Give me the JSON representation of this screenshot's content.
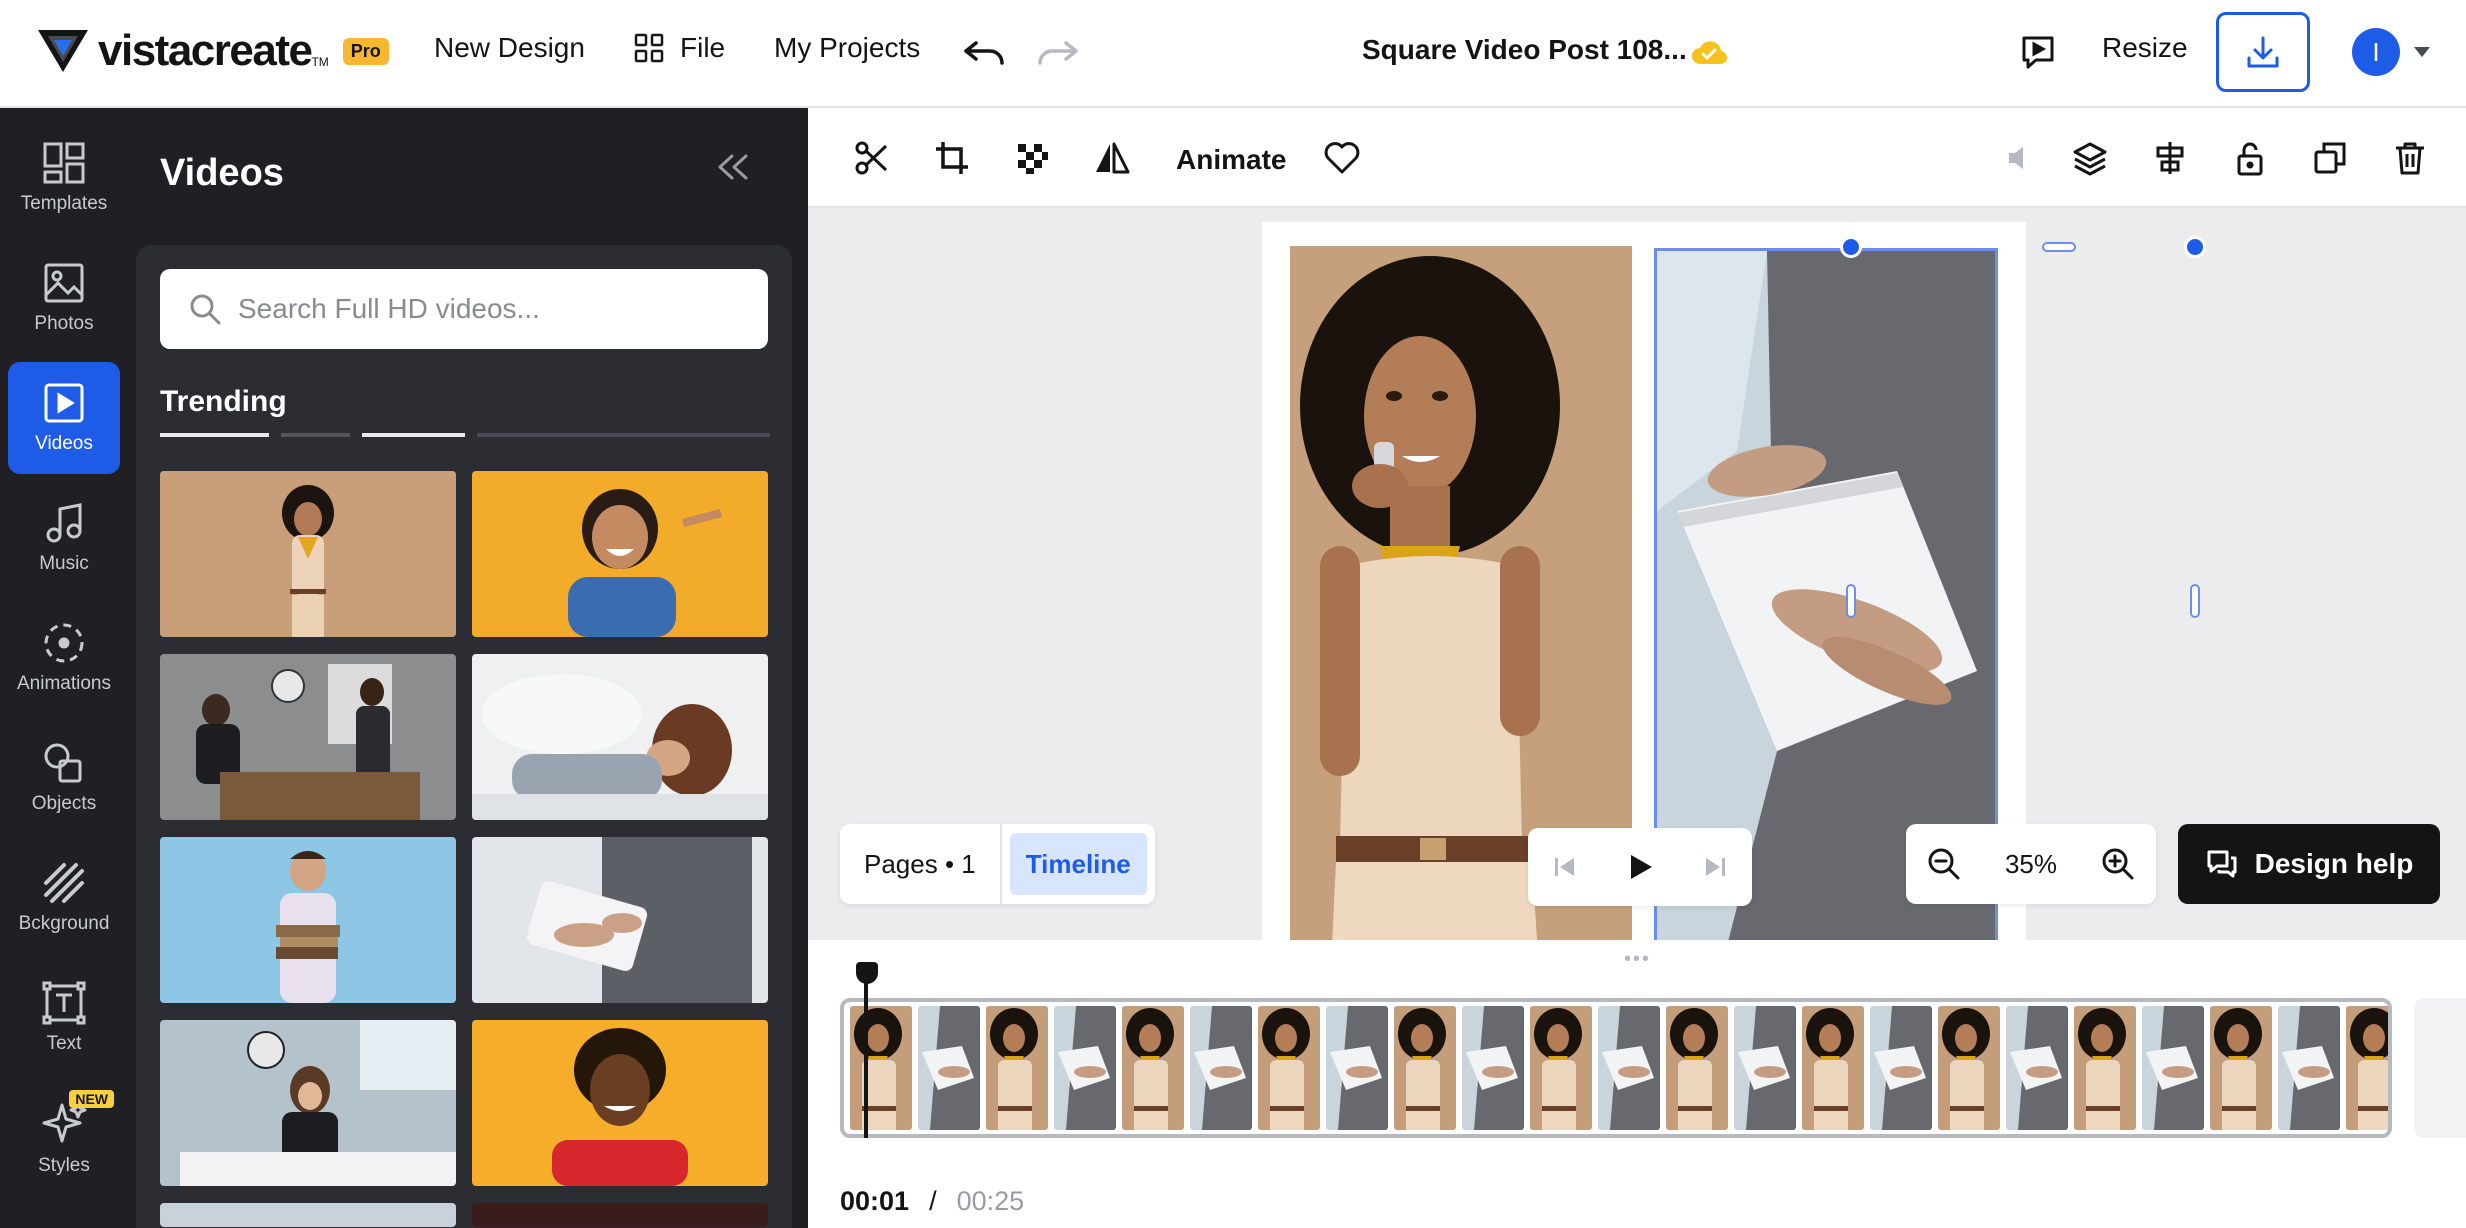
{
  "header": {
    "logo_text": "vistacreate",
    "logo_tm": "TM",
    "pro_badge": "Pro",
    "new_design": "New Design",
    "file": "File",
    "my_projects": "My Projects",
    "document_title": "Square Video Post 108...",
    "resize": "Resize",
    "avatar_initial": "I"
  },
  "rail": {
    "items": [
      {
        "label": "Templates",
        "icon": "templates-icon"
      },
      {
        "label": "Photos",
        "icon": "photos-icon"
      },
      {
        "label": "Videos",
        "icon": "videos-icon",
        "active": true
      },
      {
        "label": "Music",
        "icon": "music-icon"
      },
      {
        "label": "Animations",
        "icon": "animations-icon"
      },
      {
        "label": "Objects",
        "icon": "objects-icon"
      },
      {
        "label": "Bckground",
        "icon": "background-icon"
      },
      {
        "label": "Text",
        "icon": "text-icon"
      },
      {
        "label": "Styles",
        "icon": "styles-icon",
        "badge": "NEW"
      }
    ]
  },
  "panel": {
    "title": "Videos",
    "search_placeholder": "Search Full HD videos...",
    "section": "Trending",
    "thumbnails": [
      "woman-phone-beige",
      "girl-laughing-yellow",
      "office-meeting-clock",
      "woman-lying-bed",
      "man-holding-books",
      "hands-tablet-suit",
      "woman-desk-clock",
      "man-dreadlocks-red"
    ]
  },
  "toolbar": {
    "animate": "Animate",
    "left_icons": [
      "scissors-icon",
      "crop-icon",
      "transparency-icon",
      "flip-icon"
    ],
    "right_icons": [
      "volume-icon",
      "layers-icon",
      "align-icon",
      "lock-icon",
      "duplicate-icon",
      "delete-icon"
    ]
  },
  "canvas": {
    "pages_label": "Pages • 1",
    "timeline_label": "Timeline",
    "zoom": "35%",
    "design_help": "Design help"
  },
  "timeline": {
    "current_time": "00:01",
    "separator": "/",
    "total_time": "00:25"
  },
  "colors": {
    "accent": "#1e5ce8",
    "rail_bg": "#1f1f24",
    "pro_badge": "#f7b733"
  }
}
